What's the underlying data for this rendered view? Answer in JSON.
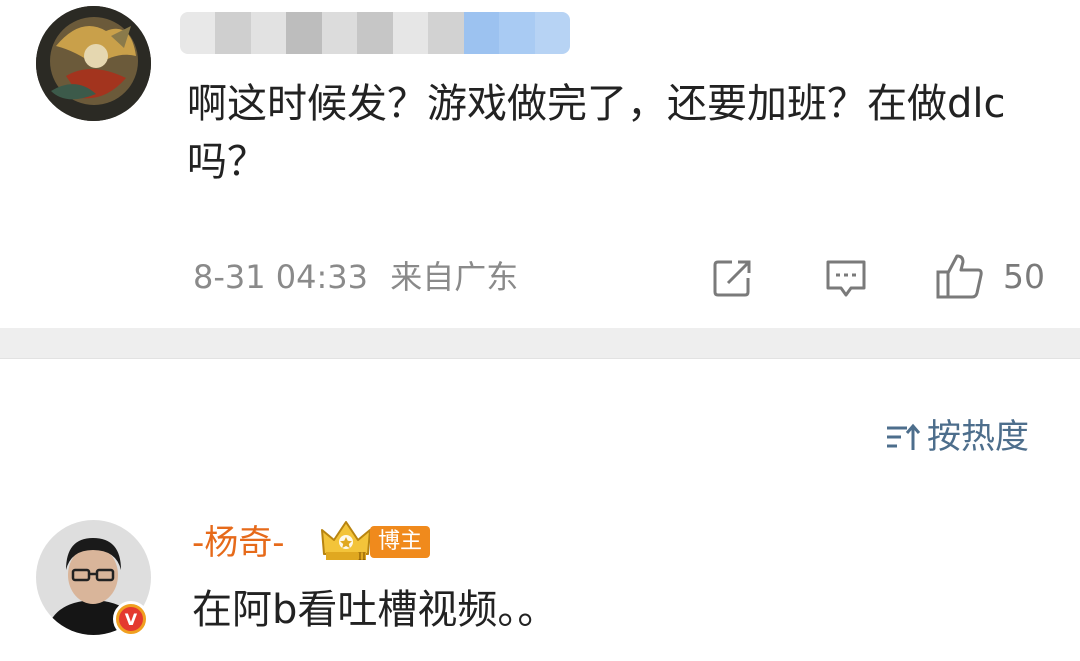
{
  "post": {
    "username_obscured": true,
    "text": "啊这时候发？游戏做完了，还要加班？在做dlc吗？",
    "timestamp": "8-31 04:33",
    "location": "来自广东",
    "like_count": "50",
    "icons": {
      "share": "share-icon",
      "comment": "comment-icon",
      "like": "thumbs-up-icon"
    }
  },
  "sort": {
    "label": "按热度",
    "icon": "sort-icon"
  },
  "comment": {
    "username": "-杨奇-",
    "badge_label": "博主",
    "rank_icon": "crown-icon",
    "verified_icon": "v-badge-icon",
    "text": "在阿b看吐槽视频。。"
  },
  "colors": {
    "name_orange": "#e66a1a",
    "link_blue": "#4d6e8c",
    "meta_gray": "#8a8a8a",
    "divider": "#eeeeee",
    "badge_orange": "#f08a1c",
    "verified_red": "#e4392f"
  }
}
